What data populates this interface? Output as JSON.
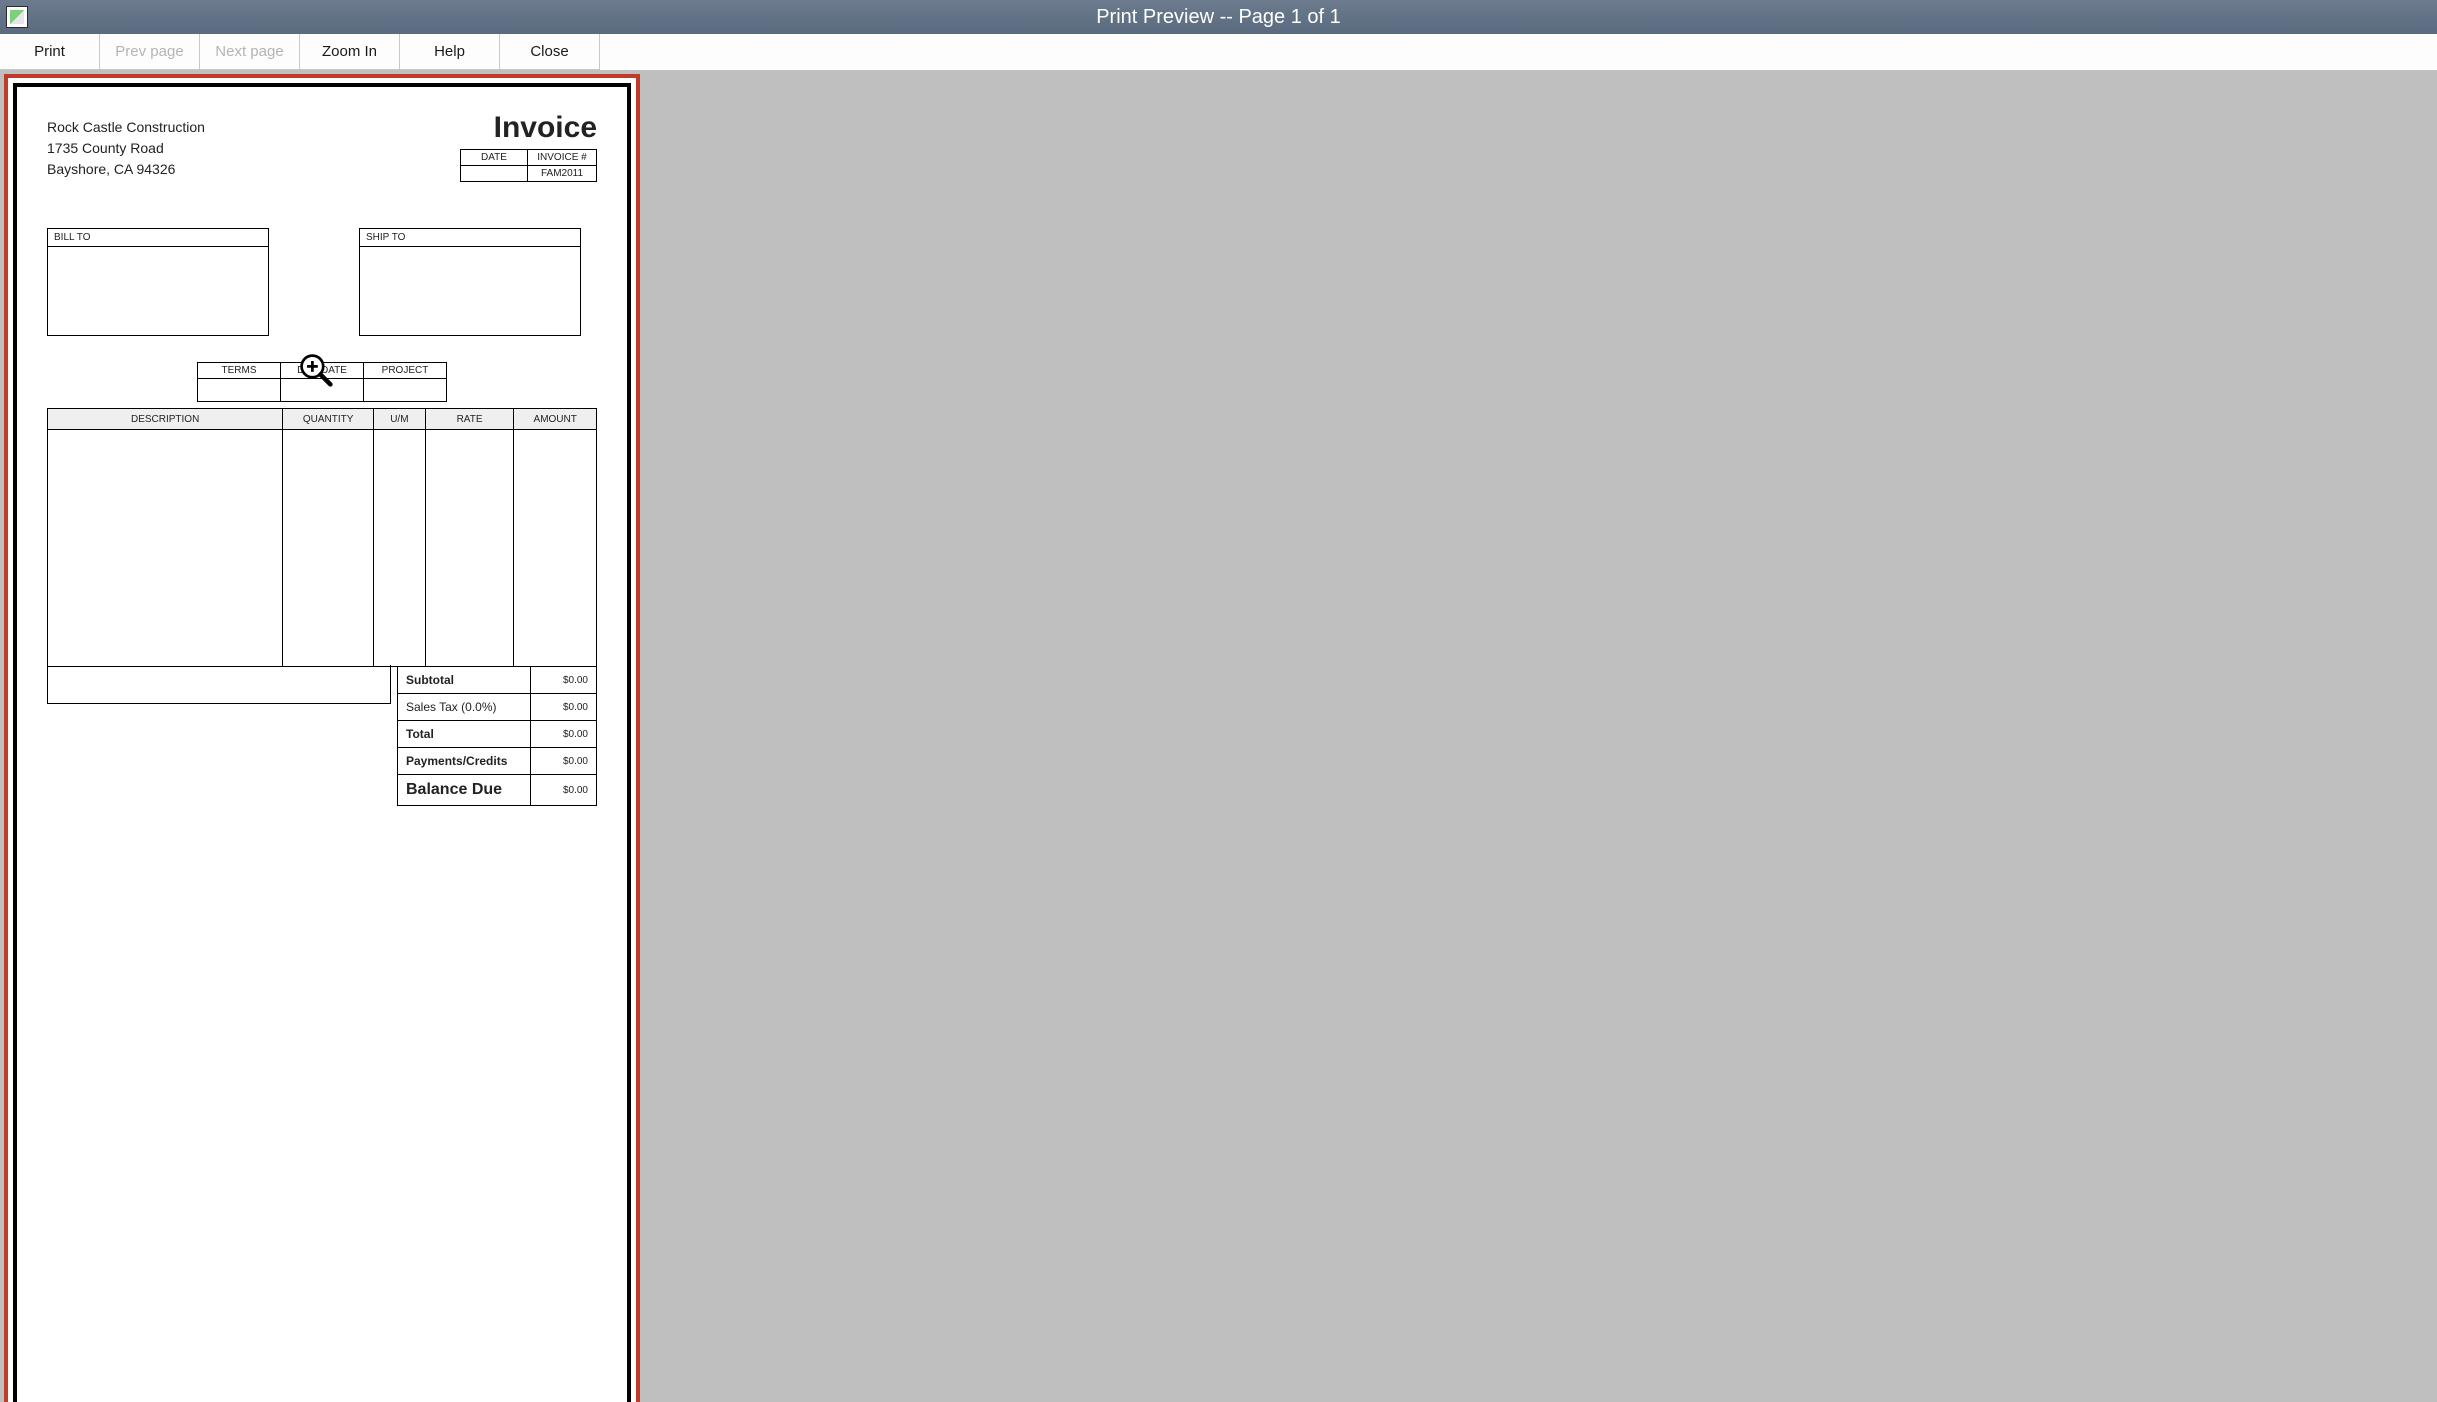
{
  "window": {
    "title": "Print Preview -- Page 1 of 1"
  },
  "toolbar": {
    "print": "Print",
    "prev": "Prev page",
    "next": "Next page",
    "zoom": "Zoom In",
    "help": "Help",
    "close": "Close"
  },
  "invoice": {
    "company_name": "Rock Castle Construction",
    "addr1": "1735 County Road",
    "addr2": "Bayshore, CA 94326",
    "title": "Invoice",
    "date_header": "DATE",
    "invno_header": "INVOICE #",
    "date_value": "",
    "invno_value": "FAM2011",
    "billto_label": "BILL TO",
    "shipto_label": "SHIP TO",
    "terms_header": "TERMS",
    "duedate_header": "DUE DATE",
    "project_header": "PROJECT",
    "terms_value": "",
    "duedate_value": "",
    "project_value": "",
    "cols": {
      "description": "DESCRIPTION",
      "quantity": "QUANTITY",
      "um": "U/M",
      "rate": "RATE",
      "amount": "AMOUNT"
    },
    "totals": {
      "subtotal_label": "Subtotal",
      "subtotal_value": "$0.00",
      "salestax_label": "Sales Tax  (0.0%)",
      "salestax_value": "$0.00",
      "total_label": "Total",
      "total_value": "$0.00",
      "payments_label": "Payments/Credits",
      "payments_value": "$0.00",
      "balance_label": "Balance Due",
      "balance_value": "$0.00"
    }
  }
}
